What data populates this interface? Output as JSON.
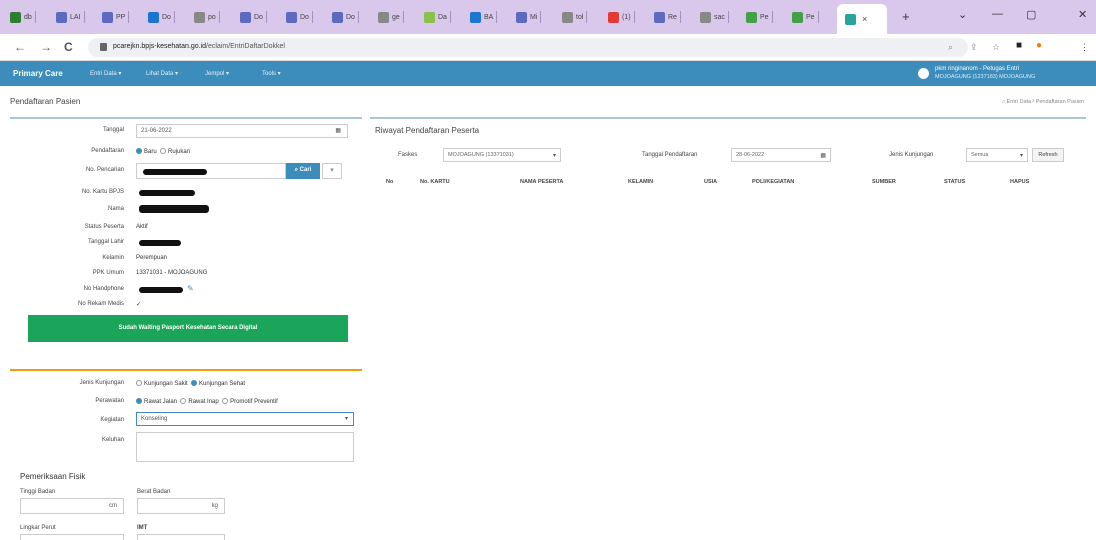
{
  "browser": {
    "tabs": [
      {
        "label": "db",
        "color": "#2e7d32"
      },
      {
        "label": "LAI",
        "color": "#5c6bc0"
      },
      {
        "label": "PP",
        "color": "#5c6bc0"
      },
      {
        "label": "Do",
        "color": "#1976d2"
      },
      {
        "label": "po",
        "color": "#888888"
      },
      {
        "label": "Do",
        "color": "#5c6bc0"
      },
      {
        "label": "Do",
        "color": "#5c6bc0"
      },
      {
        "label": "Do",
        "color": "#5c6bc0"
      },
      {
        "label": "ge",
        "color": "#888888"
      },
      {
        "label": "Da",
        "color": "#8bc34a"
      },
      {
        "label": "BA",
        "color": "#1976d2"
      },
      {
        "label": "Mi",
        "color": "#5c6bc0"
      },
      {
        "label": "tol",
        "color": "#888888"
      },
      {
        "label": "(1)",
        "color": "#e53935"
      },
      {
        "label": "Re",
        "color": "#5c6bc0"
      },
      {
        "label": "sac",
        "color": "#888888"
      },
      {
        "label": "Pe",
        "color": "#43a047"
      },
      {
        "label": "Pe",
        "color": "#43a047"
      }
    ],
    "active_tab_close": "×",
    "new_tab": "+",
    "url_domain": "pcarejkn.bpjs-kesehatan.go.id",
    "url_path": "/eclaim/EntriDaftarDokkel",
    "back": "←",
    "forward": "→",
    "reload": "C",
    "win_min": "—",
    "win_max": "▢",
    "win_close": "✕",
    "win_chevron": "⌄"
  },
  "app": {
    "brand": "Primary Care",
    "nav": [
      "Entri Data",
      "Lihat Data",
      "Jempol",
      "Tools"
    ],
    "user_line1": "pkm ringinanom - Petugas Entri",
    "user_line2": "MOJOAGUNG (1237183) MOJOAGUNG"
  },
  "page": {
    "title": "Pendaftaran Pasien",
    "breadcrumb": "Entri Data  /  Pendaftaran Pasien"
  },
  "form": {
    "tanggal_label": "Tanggal",
    "tanggal_value": "21-06-2022",
    "pendaftaran_label": "Pendaftaran",
    "pendaftaran_opt1": "Baru",
    "pendaftaran_opt2": "Rujukan",
    "no_pencarian_label": "No. Pencarian",
    "cari_label": "Cari",
    "no_kartu_label": "No. Kartu BPJS",
    "nama_label": "Nama",
    "status_label": "Status Peserta",
    "status_value": "Aktif",
    "tgl_lahir_label": "Tanggal Lahir",
    "kelamin_label": "Kelamin",
    "kelamin_value": "Perempuan",
    "ppk_label": "PPK Umum",
    "ppk_value": "13371031 - MOJOAGUNG",
    "no_hp_label": "No Handphone",
    "no_rm_label": "No Rekam Medis",
    "green_button": "Sudah Waiting Pasport Kesehatan Secara Digital",
    "jenis_kunjungan_label": "Jenis Kunjungan",
    "jk_opt1": "Kunjungan Sakit",
    "jk_opt2": "Kunjungan Sehat",
    "perawatan_label": "Perawatan",
    "pw_opt1": "Rawat Jalan",
    "pw_opt2": "Rawat Inap",
    "pw_opt3": "Promotif Preventif",
    "poli_label": "Kegiatan",
    "poli_value": "Konseling",
    "keluhan_label": "Keluhan",
    "fisik_title": "Pemeriksaan Fisik",
    "tinggi_label": "Tinggi Badan",
    "tinggi_unit": "cm",
    "berat_label": "Berat Badan",
    "berat_unit": "kg",
    "lingkar_label": "Lingkar Perut",
    "imt_label": "IMT"
  },
  "riwayat": {
    "title": "Riwayat Pendaftaran Peserta",
    "faskes_label": "Faskes",
    "faskes_value": "MOJOAGUNG (13371031)",
    "tgl_label": "Tanggal Pendaftaran",
    "tgl_value": "28-06-2022",
    "jk_label": "Jenis Kunjungan",
    "jk_value": "Semua",
    "refresh": "Refresh",
    "columns": [
      "No",
      "No. KARTU",
      "NAMA PESERTA",
      "KELAMIN",
      "USIA",
      "POLI/KEGIATAN",
      "SUMBER",
      "STATUS",
      "HAPUS"
    ]
  },
  "colors": {
    "nav": "#3c8dbc",
    "green": "#1aa55a",
    "orange": "#f39c12",
    "tabbar": "#d9c7ec"
  }
}
